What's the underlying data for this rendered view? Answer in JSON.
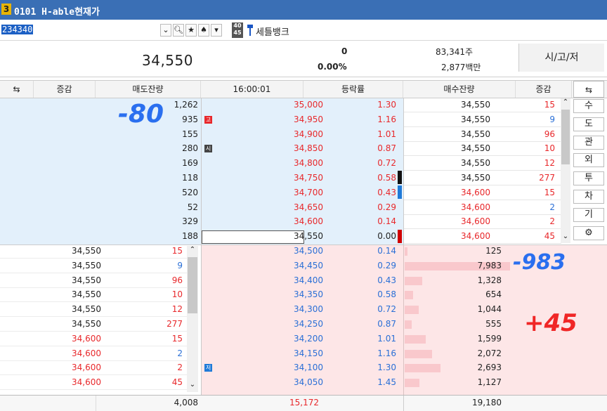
{
  "window": {
    "number": "3",
    "title": "0101 H-able현재가"
  },
  "toolbar": {
    "code": "234340",
    "sector_name": "세틀뱅크",
    "icon_label_top": "40",
    "icon_label_bottom": "45"
  },
  "summary": {
    "price": "34,550",
    "change": "0",
    "change_pct": "0.00%",
    "volume": "83,341주",
    "amount": "2,877백만",
    "button": "시/고/저"
  },
  "headers": {
    "left_icon": "⇆",
    "left_change": "증감",
    "ask_qty": "매도잔량",
    "time": "16:00:01",
    "rate": "등락률",
    "bid_qty": "매수잔량",
    "right_change": "증감",
    "right_icon": "⇆"
  },
  "asks": [
    {
      "qty": "1,262",
      "price": "35,000",
      "rate": "1.30",
      "tag": ""
    },
    {
      "qty": "935",
      "price": "34,950",
      "rate": "1.16",
      "tag": "고"
    },
    {
      "qty": "155",
      "price": "34,900",
      "rate": "1.01",
      "tag": ""
    },
    {
      "qty": "280",
      "price": "34,850",
      "rate": "0.87",
      "tag": "시"
    },
    {
      "qty": "169",
      "price": "34,800",
      "rate": "0.72",
      "tag": ""
    },
    {
      "qty": "118",
      "price": "34,750",
      "rate": "0.58",
      "tag": ""
    },
    {
      "qty": "520",
      "price": "34,700",
      "rate": "0.43",
      "tag": ""
    },
    {
      "qty": "52",
      "price": "34,650",
      "rate": "0.29",
      "tag": ""
    },
    {
      "qty": "329",
      "price": "34,600",
      "rate": "0.14",
      "tag": ""
    },
    {
      "qty": "188",
      "price": "34,550",
      "rate": "0.00",
      "tag": ""
    }
  ],
  "bids": [
    {
      "qty": "125",
      "price": "34,500",
      "rate": "0.14",
      "tag": ""
    },
    {
      "qty": "7,983",
      "price": "34,450",
      "rate": "0.29",
      "tag": ""
    },
    {
      "qty": "1,328",
      "price": "34,400",
      "rate": "0.43",
      "tag": ""
    },
    {
      "qty": "654",
      "price": "34,350",
      "rate": "0.58",
      "tag": ""
    },
    {
      "qty": "1,044",
      "price": "34,300",
      "rate": "0.72",
      "tag": ""
    },
    {
      "qty": "555",
      "price": "34,250",
      "rate": "0.87",
      "tag": ""
    },
    {
      "qty": "1,599",
      "price": "34,200",
      "rate": "1.01",
      "tag": ""
    },
    {
      "qty": "2,072",
      "price": "34,150",
      "rate": "1.16",
      "tag": ""
    },
    {
      "qty": "2,693",
      "price": "34,100",
      "rate": "1.30",
      "tag": "저"
    },
    {
      "qty": "1,127",
      "price": "34,050",
      "rate": "1.45",
      "tag": ""
    }
  ],
  "trades_right": [
    {
      "price": "34,550",
      "qty": "15"
    },
    {
      "price": "34,550",
      "qty": "9"
    },
    {
      "price": "34,550",
      "qty": "96"
    },
    {
      "price": "34,550",
      "qty": "10"
    },
    {
      "price": "34,550",
      "qty": "12"
    },
    {
      "price": "34,550",
      "qty": "277"
    },
    {
      "price": "34,600",
      "qty": "15"
    },
    {
      "price": "34,600",
      "qty": "2"
    },
    {
      "price": "34,600",
      "qty": "2"
    },
    {
      "price": "34,600",
      "qty": "45"
    }
  ],
  "side_buttons": [
    "수",
    "도",
    "관",
    "외",
    "투",
    "차",
    "기",
    "⚙"
  ],
  "totals": {
    "ask_total": "4,008",
    "diff": "15,172",
    "bid_total": "19,180"
  },
  "annotations": {
    "left": "-80",
    "right_top": "-983",
    "right_bottom": "+45"
  },
  "colors": {
    "titlebar": "#3a6fb5",
    "ask_bg": "#e3f0fb",
    "bid_bg": "#fde6e7",
    "red": "#e8282b",
    "blue": "#2a6fd6",
    "marker": "#2a6fef"
  }
}
